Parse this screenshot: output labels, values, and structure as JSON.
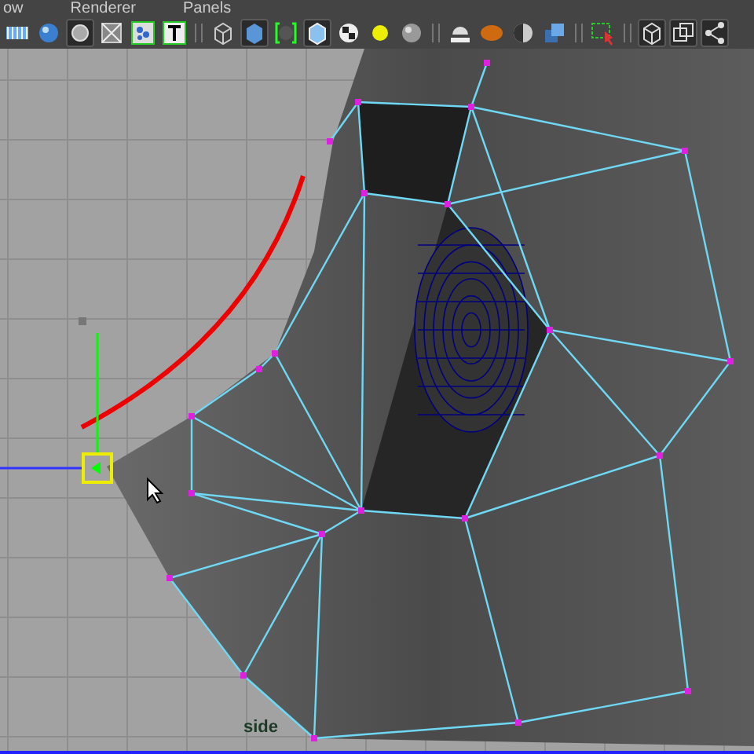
{
  "menu": [
    {
      "label": "ow"
    },
    {
      "label": "Renderer"
    },
    {
      "label": "Panels"
    }
  ],
  "toolbar": [
    {
      "kind": "button",
      "selected": false
    },
    {
      "kind": "button",
      "selected": false
    },
    {
      "kind": "button",
      "selected": true
    },
    {
      "kind": "button",
      "selected": false
    },
    {
      "kind": "button",
      "selected": false
    },
    {
      "kind": "button",
      "selected": false
    },
    {
      "kind": "separator"
    },
    {
      "kind": "button",
      "selected": false
    },
    {
      "kind": "button",
      "selected": true
    },
    {
      "kind": "button",
      "selected": false
    },
    {
      "kind": "button",
      "selected": true
    },
    {
      "kind": "button",
      "selected": false
    },
    {
      "kind": "button",
      "selected": false
    },
    {
      "kind": "button",
      "selected": false
    },
    {
      "kind": "separator"
    },
    {
      "kind": "button",
      "selected": false
    },
    {
      "kind": "button",
      "selected": false
    },
    {
      "kind": "button",
      "selected": false
    },
    {
      "kind": "button",
      "selected": false
    },
    {
      "kind": "separator"
    },
    {
      "kind": "button",
      "selected": false
    },
    {
      "kind": "separator"
    },
    {
      "kind": "button",
      "selected": true
    },
    {
      "kind": "button",
      "selected": true
    },
    {
      "kind": "button",
      "selected": true
    }
  ],
  "viewport": {
    "camera_label": "side"
  }
}
